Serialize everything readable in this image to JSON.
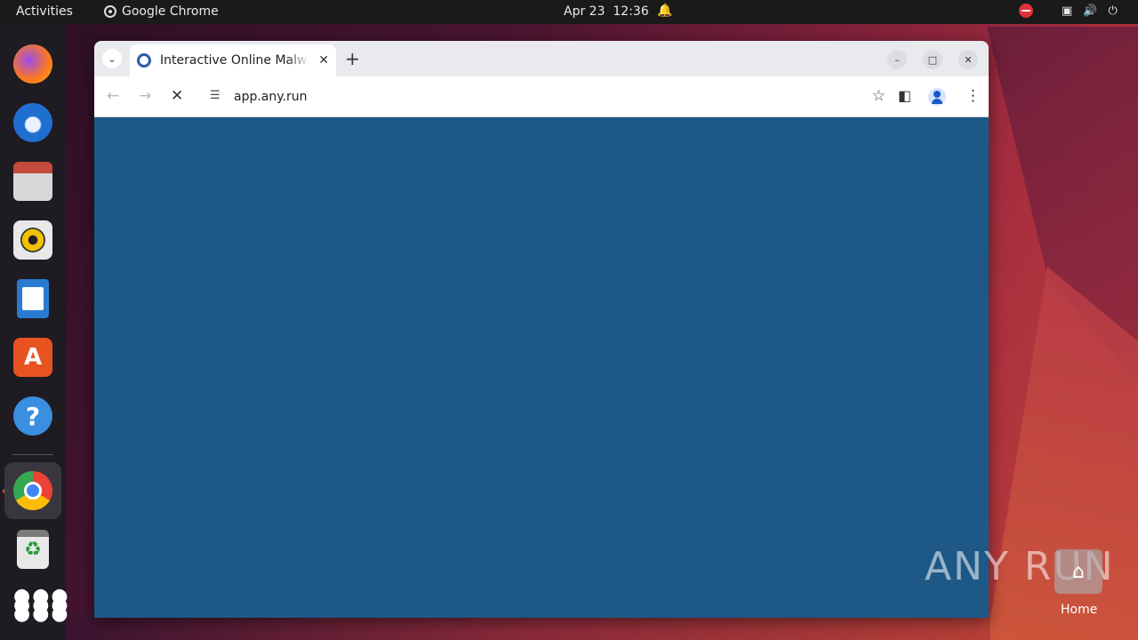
{
  "topbar": {
    "activities": "Activities",
    "app_name": "Google Chrome",
    "date": "Apr 23",
    "time": "12:36"
  },
  "dock": {
    "items": [
      {
        "name": "firefox-icon",
        "color": "#ff7a1a"
      },
      {
        "name": "thunderbird-icon",
        "color": "#1f6fd0"
      },
      {
        "name": "files-icon",
        "color": "#c44a3a"
      },
      {
        "name": "rhythmbox-icon",
        "color": "#f2c200"
      },
      {
        "name": "writer-icon",
        "color": "#2a7ad0"
      },
      {
        "name": "app-center-icon",
        "color": "#e9531f"
      },
      {
        "name": "help-icon",
        "color": "#3a8fe0"
      },
      {
        "name": "chrome-icon",
        "color": "#34a853"
      },
      {
        "name": "trash-icon",
        "color": "#5a5a5a"
      },
      {
        "name": "show-apps-icon",
        "color": "#ffffff"
      }
    ]
  },
  "browser": {
    "tab_title": "Interactive Online Malware Analysis",
    "url": "app.any.run",
    "content_color": "#1d5886"
  },
  "desktop": {
    "watermark": "ANY RUN",
    "home_label": "Home"
  }
}
